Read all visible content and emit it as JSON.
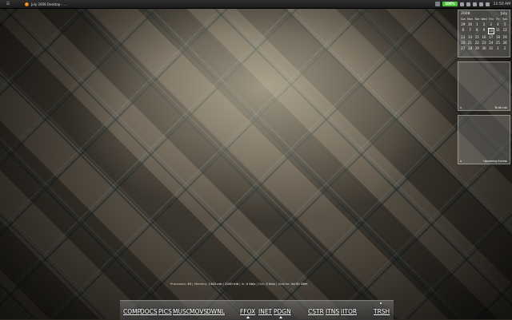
{
  "top_panel": {
    "menu_icon": "menu-icon",
    "task_title": "July 2008 Desktop - ...",
    "battery": "100%",
    "clock": "11:50 AM"
  },
  "calendar": {
    "year": "2008",
    "month": "July",
    "days": [
      "Sun",
      "Mon",
      "Tue",
      "Wed",
      "Thu",
      "Fri",
      "Sat"
    ],
    "dates": [
      "29",
      "30",
      "1",
      "2",
      "3",
      "4",
      "5",
      "6",
      "7",
      "8",
      "9",
      "10",
      "11",
      "12",
      "13",
      "14",
      "15",
      "16",
      "17",
      "18",
      "19",
      "20",
      "21",
      "22",
      "23",
      "24",
      "25",
      "26",
      "27",
      "28",
      "29",
      "30",
      "31",
      "1",
      "2"
    ],
    "today_index": 11
  },
  "widgets": {
    "todo": {
      "close": "x",
      "label": "To do List"
    },
    "events": {
      "close": "x",
      "label": "Upcoming Events"
    }
  },
  "stats": {
    "processes_label": "Processes:",
    "processes": "45",
    "memory_label": "Memory:",
    "memory": "1440 mb / 2040 mb",
    "in_label": "In:",
    "in": "0 kb/s",
    "out_label": "Out:",
    "out": "0 kb/s",
    "uptime_label": "Uptime:",
    "uptime": "0d 0h 26m"
  },
  "dock": {
    "items": [
      "COMP",
      "DOCS",
      "PICS",
      "MUSC",
      "MOVS",
      "DWNL",
      "FFOX",
      "INET",
      "PDGN",
      "CSTR",
      "ITNS",
      "IITOR",
      "TRSH"
    ]
  }
}
